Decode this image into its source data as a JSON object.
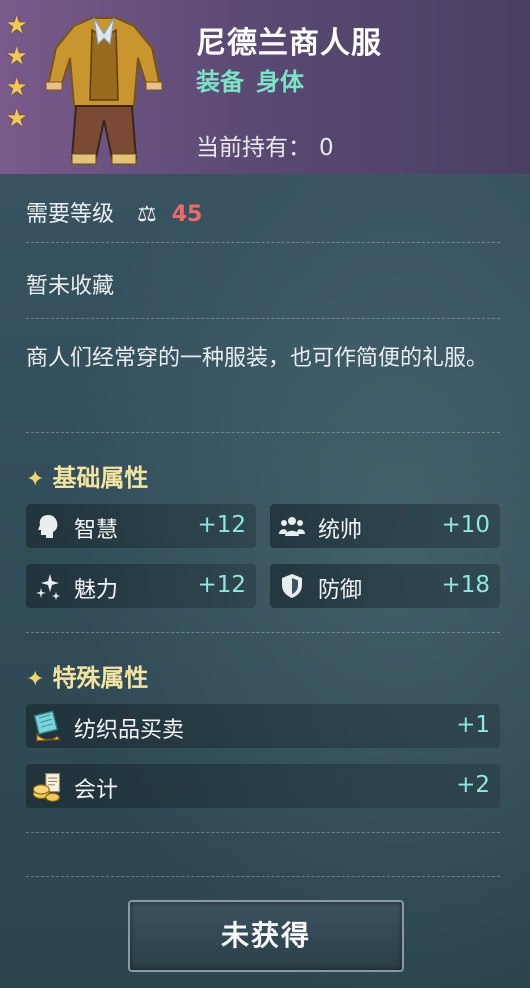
{
  "item": {
    "name": "尼德兰商人服",
    "type_primary": "装备",
    "type_secondary": "身体",
    "own_label": "当前持有：",
    "own_value": "0",
    "stars": 4
  },
  "requirement": {
    "label": "需要等级",
    "level": "45",
    "level_color": "#ee6a6a"
  },
  "collection_status": "暂未收藏",
  "description": "商人们经常穿的一种服装，也可作简便的礼服。",
  "basic_attributes": {
    "title": "基础属性",
    "items": [
      {
        "label": "智慧",
        "value": "+12",
        "icon": "head-icon"
      },
      {
        "label": "统帅",
        "value": "+10",
        "icon": "group-icon"
      },
      {
        "label": "魅力",
        "value": "+12",
        "icon": "sparkle-icon"
      },
      {
        "label": "防御",
        "value": "+18",
        "icon": "shield-icon"
      }
    ]
  },
  "special_attributes": {
    "title": "特殊属性",
    "items": [
      {
        "label": "纺织品买卖",
        "value": "+1",
        "icon": "textile-icon"
      },
      {
        "label": "会计",
        "value": "+2",
        "icon": "coins-icon"
      }
    ]
  },
  "action_button": "未获得",
  "colors": {
    "header": "#5b4a74",
    "accent_type": "#7be3c8",
    "stat_value": "#8fe6e3",
    "section_title": "#f2e3a0"
  }
}
